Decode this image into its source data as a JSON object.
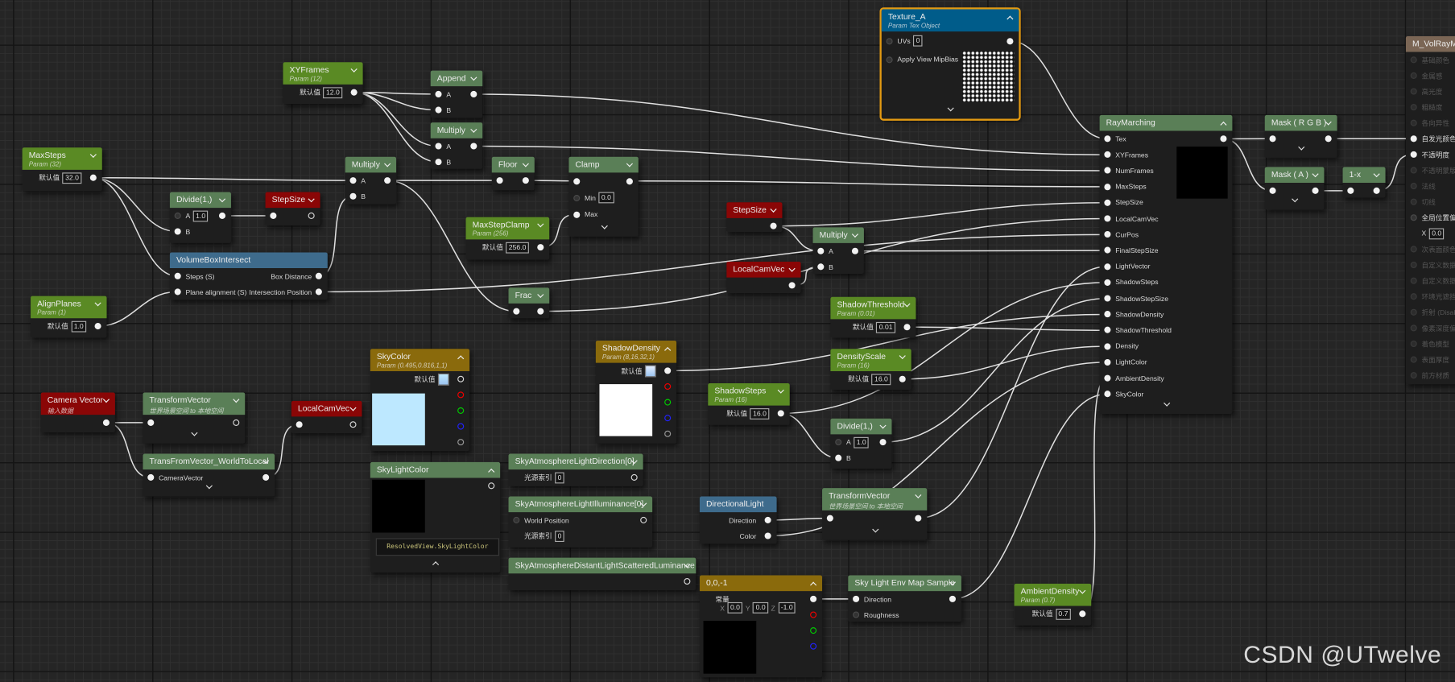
{
  "colors": {
    "param": "#5a8a24",
    "func": "#5a7f57",
    "red": "#8a0606",
    "blue": "#3e6b8c",
    "tex": "#005c8a",
    "gold": "#8a6a0c",
    "mat": "#7b6655",
    "wire": "#e0e0e0",
    "selection": "#e39a12"
  },
  "watermark": "CSDN @UTwelve",
  "nodes": [
    {
      "id": "xyframes",
      "title": "XYFrames",
      "subtitle": "Param (12)",
      "kind": "param",
      "hc": "down",
      "rows": [
        {
          "l": "默认值",
          "v": "12.0",
          "out": "linked",
          "np": 1
        }
      ]
    },
    {
      "id": "append",
      "title": "Append",
      "kind": "func",
      "hc": "down",
      "rows": [
        {
          "in": "linked",
          "l": "A",
          "out": "linked"
        },
        {
          "in": "linked",
          "l": "B"
        }
      ]
    },
    {
      "id": "mul1",
      "title": "Multiply",
      "kind": "func",
      "hc": "down",
      "rows": [
        {
          "in": "linked",
          "l": "A",
          "out": "linked"
        },
        {
          "in": "linked",
          "l": "B"
        }
      ]
    },
    {
      "id": "maxsteps",
      "title": "MaxSteps",
      "subtitle": "Param (32)",
      "kind": "param",
      "hc": "down",
      "rows": [
        {
          "l": "默认值",
          "v": "32.0",
          "out": "linked",
          "np": 1
        }
      ]
    },
    {
      "id": "mul2",
      "title": "Multiply",
      "kind": "func",
      "hc": "down",
      "rows": [
        {
          "in": "linked",
          "l": "A",
          "out": "linked"
        },
        {
          "in": "linked",
          "l": "B"
        }
      ]
    },
    {
      "id": "floor",
      "title": "Floor",
      "kind": "func",
      "hc": "down",
      "rows": [
        {
          "in": "linked",
          "out": "linked"
        }
      ]
    },
    {
      "id": "clamp",
      "title": "Clamp",
      "kind": "func",
      "hc": "down",
      "foot": "down",
      "rows": [
        {
          "in": "linked",
          "out": "linked"
        },
        {
          "in": "empty",
          "l": "Min",
          "v": "0.0"
        },
        {
          "in": "linked",
          "l": "Max"
        }
      ]
    },
    {
      "id": "div1",
      "title": "Divide(1,)",
      "kind": "func",
      "hc": "down",
      "rows": [
        {
          "in": "empty",
          "l": "A",
          "v": "1.0",
          "out": "linked"
        },
        {
          "in": "linked",
          "l": "B"
        }
      ]
    },
    {
      "id": "step1",
      "title": "StepSize",
      "kind": "red",
      "hc": "down",
      "rows": [
        {
          "in": "linked",
          "out": "empty"
        }
      ]
    },
    {
      "id": "maxstepclamp",
      "title": "MaxStepClamp",
      "subtitle": "Param (256)",
      "kind": "param",
      "hc": "down",
      "rows": [
        {
          "l": "默认值",
          "v": "256.0",
          "out": "linked",
          "np": 1
        }
      ]
    },
    {
      "id": "vbi",
      "title": "VolumeBoxIntersect",
      "kind": "blue",
      "rows": [
        {
          "in": "linked",
          "l": "Steps (S)",
          "r": "Box Distance",
          "out": "linked"
        },
        {
          "in": "linked",
          "l": "Plane alignment (S)",
          "r": "Intersection Position",
          "out": "linked"
        }
      ]
    },
    {
      "id": "alignplanes",
      "title": "AlignPlanes",
      "subtitle": "Param (1)",
      "kind": "param",
      "hc": "down",
      "rows": [
        {
          "l": "默认值",
          "v": "1.0",
          "out": "linked",
          "np": 1
        }
      ]
    },
    {
      "id": "frac",
      "title": "Frac",
      "kind": "func",
      "hc": "down",
      "rows": [
        {
          "in": "linked",
          "out": "linked"
        }
      ]
    },
    {
      "id": "texture",
      "title": "Texture_A",
      "subtitle": "Param Tex Object",
      "kind": "tex",
      "hc": "up",
      "foot": "down",
      "selected": true,
      "rows": [
        {
          "in": "empty",
          "l": "UVs",
          "v": "0",
          "out": "linked"
        },
        {
          "in": "empty",
          "l": "Apply View MipBias"
        }
      ]
    },
    {
      "id": "rm",
      "title": "RayMarching",
      "kind": "func",
      "hc": "up",
      "foot": "down",
      "rows": [
        {
          "in": "linked",
          "l": "Tex",
          "out": "linked"
        },
        {
          "in": "linked",
          "l": "XYFrames"
        },
        {
          "in": "linked",
          "l": "NumFrames"
        },
        {
          "in": "linked",
          "l": "MaxSteps"
        },
        {
          "in": "linked",
          "l": "StepSize"
        },
        {
          "in": "linked",
          "l": "LocalCamVec"
        },
        {
          "in": "linked",
          "l": "CurPos"
        },
        {
          "in": "linked",
          "l": "FinalStepSize"
        },
        {
          "in": "linked",
          "l": "LightVector"
        },
        {
          "in": "linked",
          "l": "ShadowSteps"
        },
        {
          "in": "linked",
          "l": "ShadowStepSize"
        },
        {
          "in": "linked",
          "l": "ShadowDensity"
        },
        {
          "in": "linked",
          "l": "ShadowThreshold"
        },
        {
          "in": "linked",
          "l": "Density"
        },
        {
          "in": "linked",
          "l": "LightColor"
        },
        {
          "in": "linked",
          "l": "AmbientDensity"
        },
        {
          "in": "linked",
          "l": "SkyColor"
        }
      ]
    },
    {
      "id": "maskrgb",
      "title": "Mask ( R G B )",
      "kind": "func",
      "hc": "down",
      "foot": "down",
      "rows": [
        {
          "in": "linked",
          "out": "linked"
        }
      ]
    },
    {
      "id": "maska",
      "title": "Mask ( A )",
      "kind": "func",
      "hc": "down",
      "foot": "down",
      "rows": [
        {
          "in": "linked",
          "out": "linked"
        }
      ]
    },
    {
      "id": "oneminus",
      "title": "1-x",
      "kind": "func",
      "hc": "down",
      "rows": [
        {
          "in": "linked",
          "out": "linked"
        }
      ]
    },
    {
      "id": "mat",
      "title": "M_VolRayMa",
      "kind": "mat",
      "rows": [
        {
          "in": "dim",
          "l": "基础颜色",
          "dim": true
        },
        {
          "in": "dim",
          "l": "金属感",
          "dim": true
        },
        {
          "in": "dim",
          "l": "高光度",
          "dim": true
        },
        {
          "in": "dim",
          "l": "粗糙度",
          "dim": true
        },
        {
          "in": "dim",
          "l": "各向异性",
          "dim": true
        },
        {
          "in": "linked",
          "l": "自发光颜色"
        },
        {
          "in": "linked",
          "l": "不透明度"
        },
        {
          "in": "dim",
          "l": "不透明蒙版",
          "dim": true
        },
        {
          "in": "dim",
          "l": "法线",
          "dim": true
        },
        {
          "in": "dim",
          "l": "切线",
          "dim": true
        },
        {
          "in": "empty",
          "l": "全局位置偏"
        },
        {
          "l": "X",
          "v": "0.0"
        },
        {
          "in": "dim",
          "l": "次表面颜色",
          "dim": true
        },
        {
          "in": "dim",
          "l": "自定义数据",
          "dim": true
        },
        {
          "in": "dim",
          "l": "自定义数据",
          "dim": true
        },
        {
          "in": "dim",
          "l": "环境光遮挡",
          "dim": true
        },
        {
          "in": "dim",
          "l": "折射 (Disab",
          "dim": true
        },
        {
          "in": "dim",
          "l": "像素深度偏",
          "dim": true
        },
        {
          "in": "dim",
          "l": "着色模型",
          "dim": true
        },
        {
          "in": "dim",
          "l": "表面厚度",
          "dim": true
        },
        {
          "in": "dim",
          "l": "前方材质",
          "dim": true
        }
      ]
    },
    {
      "id": "step2",
      "title": "StepSize",
      "kind": "red",
      "hc": "down",
      "rows": [
        {
          "out": "linked"
        }
      ]
    },
    {
      "id": "mul3",
      "title": "Multiply",
      "kind": "func",
      "hc": "down",
      "rows": [
        {
          "in": "linked",
          "l": "A",
          "out": "linked"
        },
        {
          "in": "linked",
          "l": "B"
        }
      ]
    },
    {
      "id": "lcv2",
      "title": "LocalCamVec",
      "kind": "red",
      "hc": "down",
      "rows": [
        {
          "out": "linked"
        }
      ]
    },
    {
      "id": "shadowthr",
      "title": "ShadowThreshold",
      "subtitle": "Param (0.01)",
      "kind": "param",
      "hc": "down",
      "rows": [
        {
          "l": "默认值",
          "v": "0.01",
          "out": "linked",
          "np": 1
        }
      ]
    },
    {
      "id": "densityscale",
      "title": "DensityScale",
      "subtitle": "Param (16)",
      "kind": "param",
      "hc": "down",
      "rows": [
        {
          "l": "默认值",
          "v": "16.0",
          "out": "linked",
          "np": 1
        }
      ]
    },
    {
      "id": "shadowsteps",
      "title": "ShadowSteps",
      "subtitle": "Param (16)",
      "kind": "param",
      "hc": "down",
      "rows": [
        {
          "l": "默认值",
          "v": "16.0",
          "out": "linked",
          "np": 1
        }
      ]
    },
    {
      "id": "div2",
      "title": "Divide(1,)",
      "kind": "func",
      "hc": "down",
      "rows": [
        {
          "in": "empty",
          "l": "A",
          "v": "1.0",
          "out": "linked"
        },
        {
          "in": "linked",
          "l": "B"
        }
      ]
    },
    {
      "id": "skycolor",
      "title": "SkyColor",
      "subtitle": "Param (0.495,0.816,1,1)",
      "kind": "gold",
      "hc": "up",
      "swatch": "#bde8ff",
      "rows": [
        {
          "l": "默认值",
          "sw": "#bde8ff",
          "out": "empty",
          "np": 1
        },
        {
          "out": "red"
        },
        {
          "out": "green"
        },
        {
          "out": "blue"
        },
        {
          "out": "alpha"
        }
      ]
    },
    {
      "id": "shadowdensity",
      "title": "ShadowDensity",
      "subtitle": "Param (8,16,32,1)",
      "kind": "gold",
      "hc": "up",
      "swatch": "#ffffff",
      "rows": [
        {
          "l": "默认值",
          "sw": "#e4eeff",
          "out": "linked",
          "np": 1
        },
        {
          "out": "red"
        },
        {
          "out": "green"
        },
        {
          "out": "blue"
        },
        {
          "out": "alpha"
        }
      ]
    },
    {
      "id": "camvec",
      "title": "Camera Vector",
      "subtitle": "输入数据",
      "kind": "red",
      "hc": "down",
      "rows": [
        {
          "out": "linked"
        }
      ]
    },
    {
      "id": "tv1",
      "title": "TransformVector",
      "subtitle": "世界场景空间 to 本地空间",
      "kind": "func",
      "hc": "down",
      "foot": "down",
      "rows": [
        {
          "in": "linked",
          "out": "empty"
        }
      ]
    },
    {
      "id": "lcv1",
      "title": "LocalCamVec",
      "kind": "red",
      "hc": "down",
      "rows": [
        {
          "in": "linked",
          "out": "empty"
        }
      ]
    },
    {
      "id": "tfv",
      "title": "TransFromVector_WorldToLocal",
      "kind": "func",
      "hc": "down",
      "foot": "down",
      "rows": [
        {
          "in": "linked",
          "l": "CameraVector",
          "out": "linked"
        }
      ]
    },
    {
      "id": "skylight",
      "title": "SkyLightColor",
      "kind": "func",
      "hc": "up",
      "foot": "up",
      "swatch": "#000000",
      "code": "ResolvedView.SkyLightColor",
      "rows": [
        {
          "out": "empty"
        }
      ]
    },
    {
      "id": "sald",
      "title": "SkyAtmosphereLightDirection[0]",
      "kind": "func",
      "hc": "down",
      "rows": [
        {
          "l": "光源索引",
          "v": "0",
          "out": "empty"
        }
      ]
    },
    {
      "id": "sali",
      "title": "SkyAtmosphereLightIlluminance[0]",
      "kind": "func",
      "hc": "down",
      "rows": [
        {
          "in": "empty",
          "l": "World Position",
          "out": "empty"
        },
        {
          "l": "光源索引",
          "v": "0"
        }
      ]
    },
    {
      "id": "sadl",
      "title": "SkyAtmosphereDistantLightScatteredLuminance",
      "kind": "func",
      "hc": "down",
      "rows": [
        {
          "out": "empty"
        }
      ]
    },
    {
      "id": "dl",
      "title": "DirectionalLight",
      "kind": "blue",
      "rows": [
        {
          "l": "Direction",
          "out": "linked",
          "np": 1
        },
        {
          "l": "Color",
          "out": "linked",
          "np": 1
        }
      ]
    },
    {
      "id": "tv2",
      "title": "TransformVector",
      "subtitle": "世界场景空间 to 本地空间",
      "kind": "func",
      "hc": "down",
      "foot": "down",
      "rows": [
        {
          "in": "linked",
          "out": "linked"
        }
      ]
    },
    {
      "id": "const",
      "title": "0,0,-1",
      "kind": "gold",
      "hc": "up",
      "swatch": "#000000",
      "xyz": [
        "0.0",
        "0.0",
        "-1.0"
      ],
      "xyz_labels": [
        "X",
        "Y",
        "Z"
      ],
      "rows": [
        {
          "l": "常量",
          "out": "linked"
        },
        {
          "out": "red"
        },
        {
          "out": "green"
        },
        {
          "out": "blue"
        }
      ]
    },
    {
      "id": "sles",
      "title": "Sky Light Env Map Sample",
      "kind": "func",
      "hc": "down",
      "rows": [
        {
          "in": "linked",
          "l": "Direction",
          "out": "linked"
        },
        {
          "in": "empty",
          "l": "Roughness"
        }
      ]
    },
    {
      "id": "ambient",
      "title": "AmbientDensity",
      "subtitle": "Param (0.7)",
      "kind": "param",
      "hc": "down",
      "rows": [
        {
          "l": "默认值",
          "v": "0.7",
          "out": "linked",
          "np": 1
        }
      ]
    }
  ]
}
